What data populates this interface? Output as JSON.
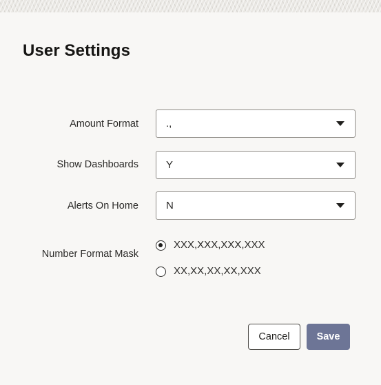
{
  "dialog": {
    "title": "User Settings"
  },
  "form": {
    "amount_format": {
      "label": "Amount Format",
      "value": ".,"
    },
    "show_dashboards": {
      "label": "Show Dashboards",
      "value": "Y"
    },
    "alerts_on_home": {
      "label": "Alerts On Home",
      "value": "N"
    },
    "number_format_mask": {
      "label": "Number Format Mask",
      "options": [
        {
          "label": "XXX,XXX,XXX,XXX",
          "selected": true
        },
        {
          "label": "XX,XX,XX,XX,XXX",
          "selected": false
        }
      ]
    }
  },
  "actions": {
    "cancel_label": "Cancel",
    "save_label": "Save"
  },
  "colors": {
    "background": "#f8f7f5",
    "save_button": "#6d7596",
    "text": "#2b2a28"
  }
}
